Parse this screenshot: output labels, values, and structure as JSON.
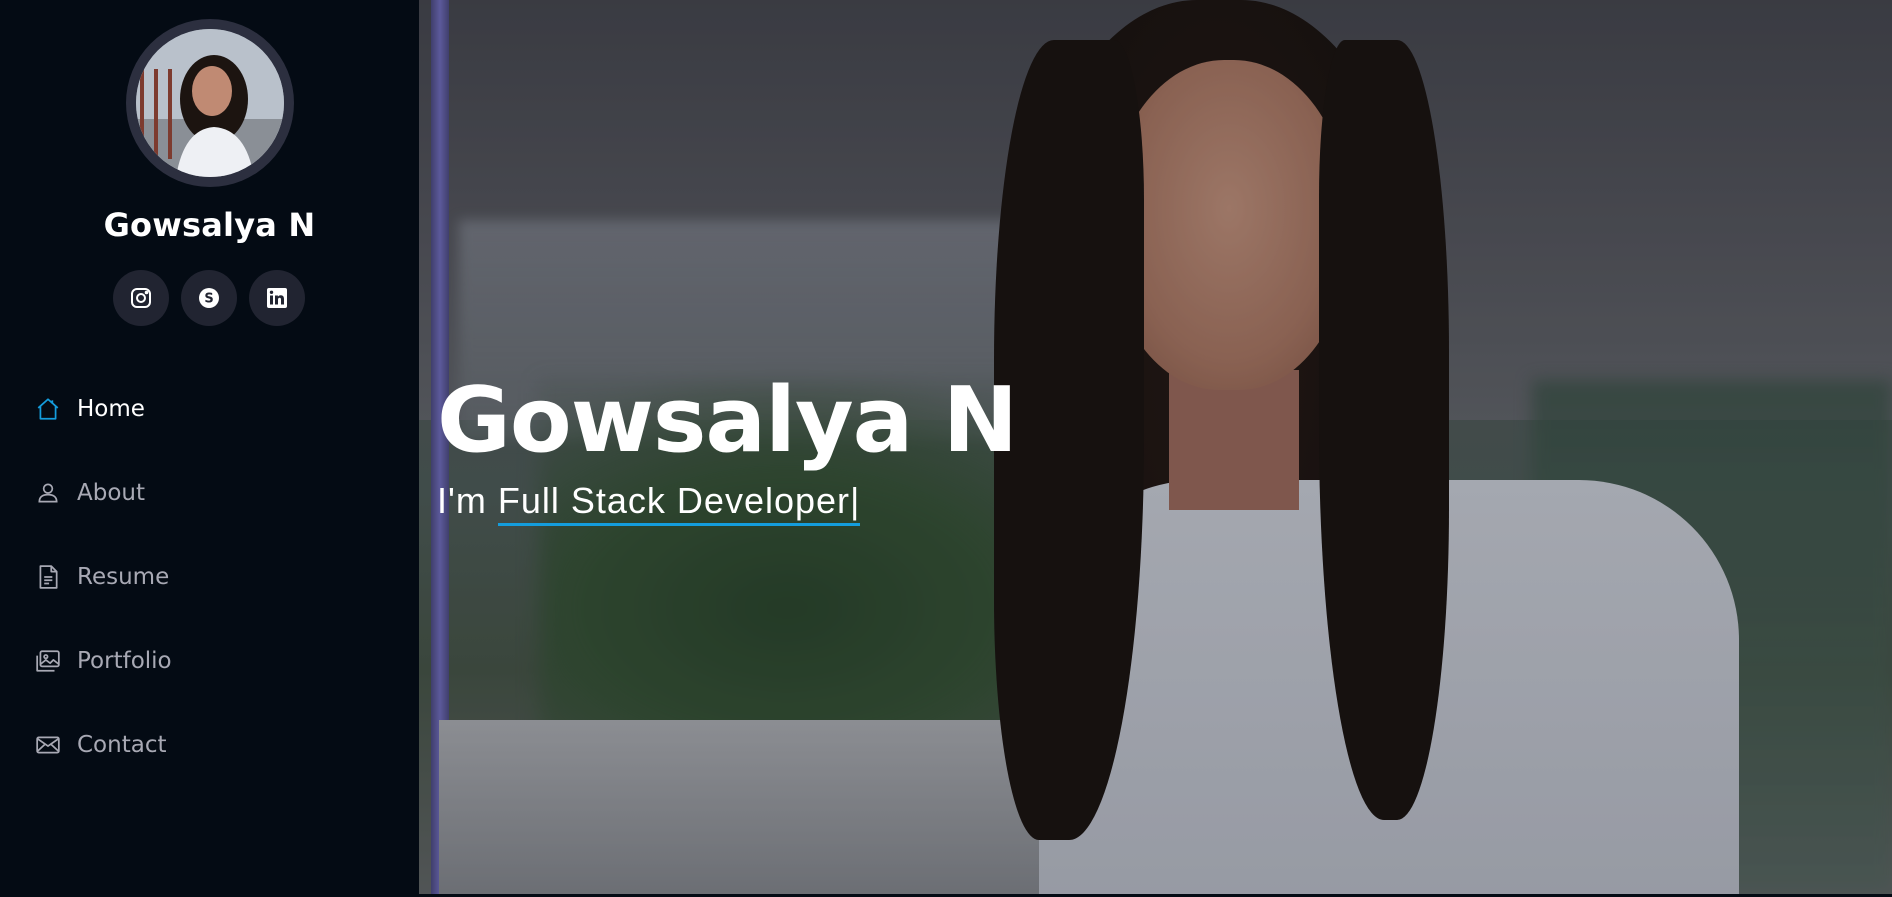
{
  "profile": {
    "name": "Gowsalya N"
  },
  "social": [
    {
      "icon": "instagram-icon"
    },
    {
      "icon": "skype-icon"
    },
    {
      "icon": "linkedin-icon"
    }
  ],
  "nav": {
    "items": [
      {
        "label": "Home",
        "icon": "home-icon",
        "active": true
      },
      {
        "label": "About",
        "icon": "person-icon",
        "active": false
      },
      {
        "label": "Resume",
        "icon": "file-text-icon",
        "active": false
      },
      {
        "label": "Portfolio",
        "icon": "images-icon",
        "active": false
      },
      {
        "label": "Contact",
        "icon": "envelope-icon",
        "active": false
      }
    ]
  },
  "hero": {
    "title": "Gowsalya N",
    "prefix": "I'm ",
    "typed": "Full Stack Developer",
    "cursor": "|"
  },
  "colors": {
    "accent": "#149ddd",
    "sidebar_bg": "#040b14",
    "social_bg": "#212431",
    "nav_text": "#a8a9b4"
  }
}
